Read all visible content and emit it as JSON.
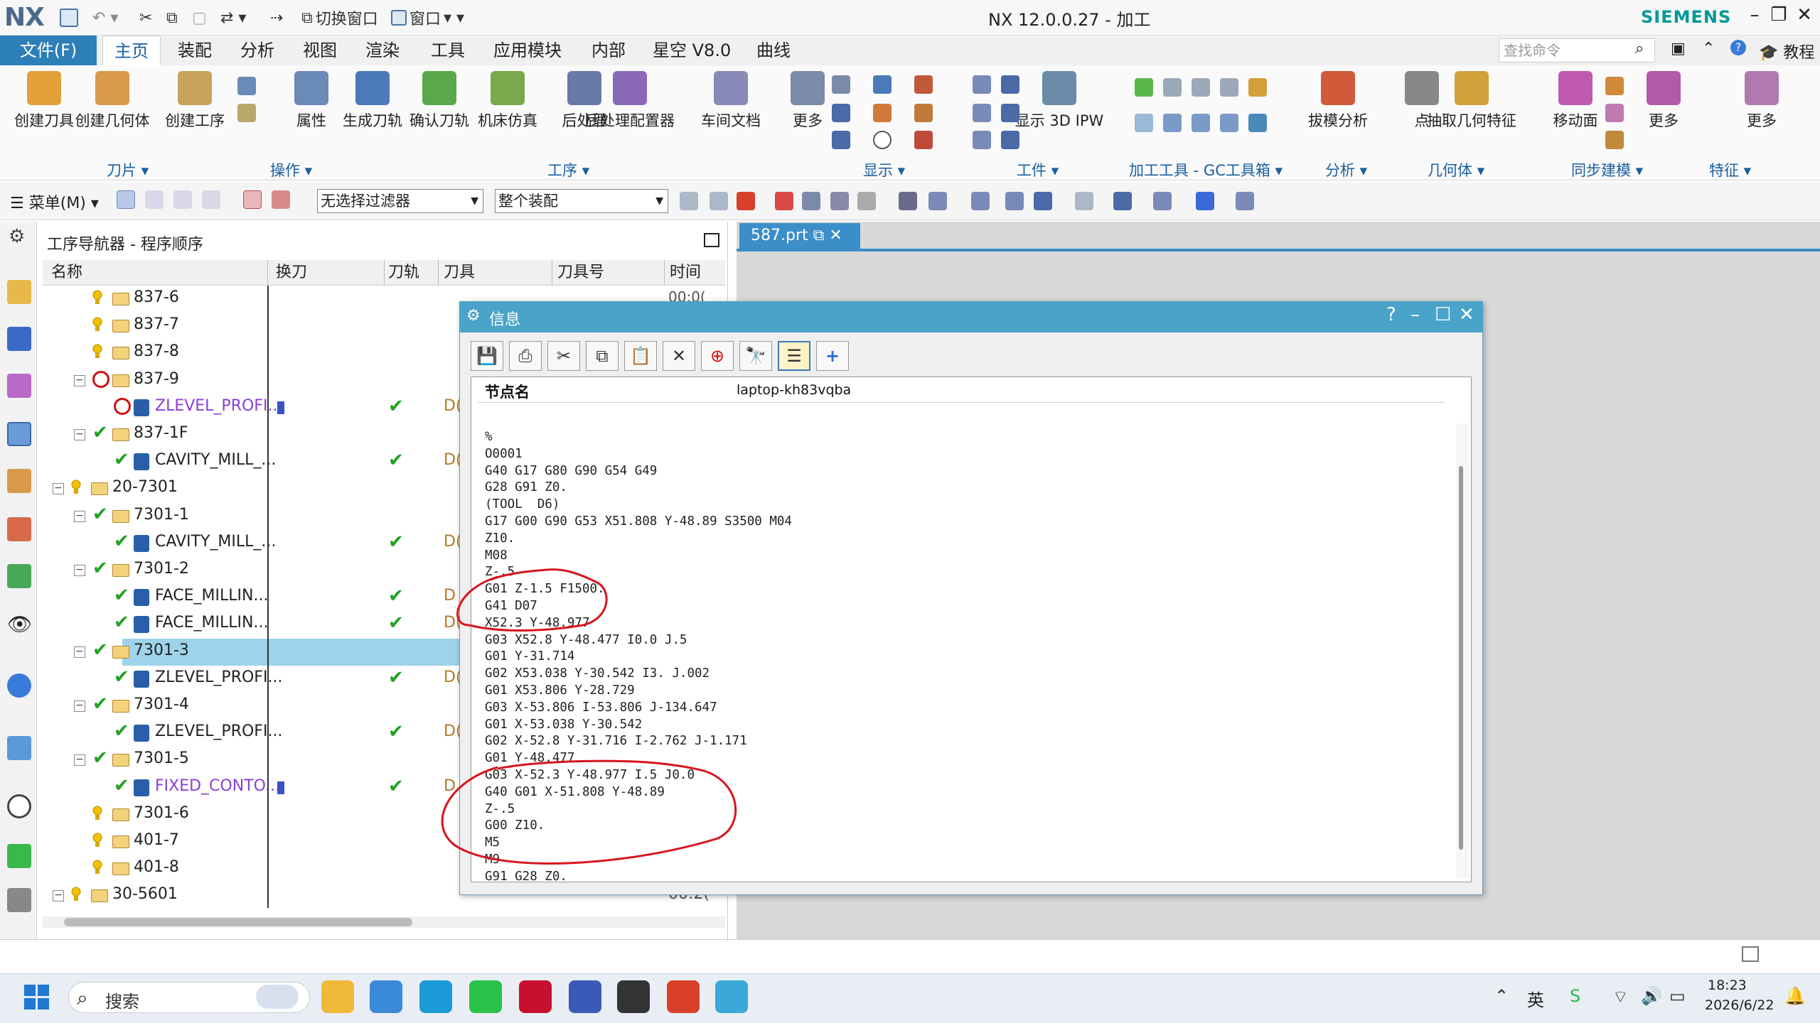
{
  "titlebar": {
    "logo": "NX",
    "switch_window": "切换窗口",
    "window": "窗口",
    "title": "NX 12.0.0.27 - 加工",
    "brand": "SIEMENS"
  },
  "menubar": {
    "file": "文件(F)",
    "tabs": [
      "主页",
      "装配",
      "分析",
      "视图",
      "渲染",
      "工具",
      "应用模块",
      "内部",
      "星空 V8.0",
      "曲线"
    ],
    "search_placeholder": "查找命令",
    "tutorial": "教程"
  },
  "ribbon": {
    "buttons": [
      {
        "label": "创建刀具",
        "icon": "create-tool-icon",
        "color": "#e3a13a"
      },
      {
        "label": "创建几何体",
        "icon": "create-geometry-icon",
        "color": "#d99a4a"
      },
      {
        "label": "创建工序",
        "icon": "create-operation-icon",
        "color": "#c7a45a"
      },
      {
        "label": "属性",
        "icon": "properties-icon",
        "color": "#6a8ab8"
      },
      {
        "label": "生成刀轨",
        "icon": "generate-toolpath-icon",
        "color": "#4a7ab8"
      },
      {
        "label": "确认刀轨",
        "icon": "verify-toolpath-icon",
        "color": "#5aa84a"
      },
      {
        "label": "机床仿真",
        "icon": "machine-simulation-icon",
        "color": "#7aa84a"
      },
      {
        "label": "后处理",
        "icon": "postprocess-icon",
        "color": "#6a7aa8"
      },
      {
        "label": "后处理配置器",
        "icon": "post-configurator-icon",
        "color": "#8a6ab8"
      },
      {
        "label": "车间文档",
        "icon": "shop-documentation-icon",
        "color": "#8a8ab8"
      },
      {
        "label": "更多",
        "icon": "more-icon",
        "color": "#7a8aa8"
      },
      {
        "label": "显示 3D IPW",
        "icon": "show-3d-ipw-icon",
        "color": "#6a8aa8"
      },
      {
        "label": "拔模分析",
        "icon": "draft-analysis-icon",
        "color": "#d05a3a"
      },
      {
        "label": "点",
        "icon": "point-icon",
        "color": "#888888"
      },
      {
        "label": "抽取几何特征",
        "icon": "extract-geometry-icon",
        "color": "#d0a03a"
      },
      {
        "label": "移动面",
        "icon": "move-face-icon",
        "color": "#c05ab0"
      },
      {
        "label": "更多",
        "icon": "more-icon-2",
        "color": "#b05aa8"
      },
      {
        "label": "更多",
        "icon": "more-icon-3",
        "color": "#b07ab0"
      }
    ],
    "groups": [
      "刀片",
      "操作",
      "工序",
      "显示",
      "工件",
      "加工工具 - GC工具箱",
      "分析",
      "几何体",
      "同步建模",
      "特征"
    ]
  },
  "toolbar2": {
    "menu": "菜单(M)",
    "filter": "无选择过滤器",
    "assembly": "整个装配"
  },
  "navigator": {
    "title": "工序导航器 - 程序顺序",
    "columns": [
      "名称",
      "换刀",
      "刀轨",
      "刀具",
      "刀具号",
      "时间"
    ],
    "first_time": "00:0(",
    "rows": [
      {
        "indent": 2,
        "toggle": "",
        "status": "bulb",
        "type": "folder",
        "name": "837-6",
        "purple": false,
        "bar": false,
        "tick": false,
        "tool": ""
      },
      {
        "indent": 2,
        "toggle": "",
        "status": "bulb",
        "type": "folder",
        "name": "837-7",
        "purple": false,
        "bar": false,
        "tick": false,
        "tool": ""
      },
      {
        "indent": 2,
        "toggle": "",
        "status": "bulb",
        "type": "folder",
        "name": "837-8",
        "purple": false,
        "bar": false,
        "tick": false,
        "tool": ""
      },
      {
        "indent": 2,
        "toggle": "−",
        "status": "forbid",
        "type": "folder",
        "name": "837-9",
        "purple": false,
        "bar": false,
        "tick": false,
        "tool": ""
      },
      {
        "indent": 3,
        "toggle": "",
        "status": "forbid",
        "type": "op",
        "name": "ZLEVEL_PROFI...",
        "purple": true,
        "bar": true,
        "tick": true,
        "tool": "D("
      },
      {
        "indent": 2,
        "toggle": "−",
        "status": "check",
        "type": "folder",
        "name": "837-1F",
        "purple": false,
        "bar": false,
        "tick": false,
        "tool": ""
      },
      {
        "indent": 3,
        "toggle": "",
        "status": "check",
        "type": "op",
        "name": "CAVITY_MILL_...",
        "purple": false,
        "bar": false,
        "tick": true,
        "tool": "D("
      },
      {
        "indent": 1,
        "toggle": "−",
        "status": "bulb",
        "type": "folder",
        "name": "20-7301",
        "purple": false,
        "bar": false,
        "tick": false,
        "tool": ""
      },
      {
        "indent": 2,
        "toggle": "−",
        "status": "check",
        "type": "folder",
        "name": "7301-1",
        "purple": false,
        "bar": false,
        "tick": false,
        "tool": ""
      },
      {
        "indent": 3,
        "toggle": "",
        "status": "check",
        "type": "op",
        "name": "CAVITY_MILL_...",
        "purple": false,
        "bar": false,
        "tick": true,
        "tool": "D("
      },
      {
        "indent": 2,
        "toggle": "−",
        "status": "check",
        "type": "folder",
        "name": "7301-2",
        "purple": false,
        "bar": false,
        "tick": false,
        "tool": ""
      },
      {
        "indent": 3,
        "toggle": "",
        "status": "check",
        "type": "op",
        "name": "FACE_MILLIN...",
        "purple": false,
        "bar": false,
        "tick": true,
        "tool": "D"
      },
      {
        "indent": 3,
        "toggle": "",
        "status": "check",
        "type": "op",
        "name": "FACE_MILLIN...",
        "purple": false,
        "bar": false,
        "tick": true,
        "tool": "D("
      },
      {
        "indent": 2,
        "toggle": "−",
        "status": "check",
        "type": "folder",
        "name": "7301-3",
        "purple": false,
        "bar": false,
        "tick": false,
        "tool": "",
        "selected": true
      },
      {
        "indent": 3,
        "toggle": "",
        "status": "check",
        "type": "op",
        "name": "ZLEVEL_PROFI...",
        "purple": false,
        "bar": false,
        "tick": true,
        "tool": "D("
      },
      {
        "indent": 2,
        "toggle": "−",
        "status": "check",
        "type": "folder",
        "name": "7301-4",
        "purple": false,
        "bar": false,
        "tick": false,
        "tool": ""
      },
      {
        "indent": 3,
        "toggle": "",
        "status": "check",
        "type": "op",
        "name": "ZLEVEL_PROFI...",
        "purple": false,
        "bar": false,
        "tick": true,
        "tool": "D("
      },
      {
        "indent": 2,
        "toggle": "−",
        "status": "check",
        "type": "folder",
        "name": "7301-5",
        "purple": false,
        "bar": false,
        "tick": false,
        "tool": ""
      },
      {
        "indent": 3,
        "toggle": "",
        "status": "check",
        "type": "op",
        "name": "FIXED_CONTO...",
        "purple": true,
        "bar": true,
        "tick": true,
        "tool": "D"
      },
      {
        "indent": 2,
        "toggle": "",
        "status": "bulb",
        "type": "folder",
        "name": "7301-6",
        "purple": false,
        "bar": false,
        "tick": false,
        "tool": ""
      },
      {
        "indent": 2,
        "toggle": "",
        "status": "bulb",
        "type": "folder",
        "name": "401-7",
        "purple": false,
        "bar": false,
        "tick": false,
        "tool": ""
      },
      {
        "indent": 2,
        "toggle": "",
        "status": "bulb",
        "type": "folder",
        "name": "401-8",
        "purple": false,
        "bar": false,
        "tick": false,
        "tool": ""
      },
      {
        "indent": 1,
        "toggle": "−",
        "status": "bulb",
        "type": "folder",
        "name": "30-5601",
        "purple": false,
        "bar": false,
        "tick": false,
        "tool": "",
        "time": "00:2("
      }
    ]
  },
  "graphics": {
    "file_tab": "587.prt"
  },
  "info_dialog": {
    "title": "信息",
    "node_label": "节点名",
    "node_value": "laptop-kh83vqba",
    "code_lines": [
      "%",
      "O0001",
      "G40 G17 G80 G90 G54 G49",
      "G28 G91 Z0.",
      "(TOOL  D6)",
      "G17 G00 G90 G53 X51.808 Y-48.89 S3500 M04",
      "Z10.",
      "M08",
      "Z-.5",
      "G01 Z-1.5 F1500.",
      "G41 D07",
      "X52.3 Y-48.977",
      "G03 X52.8 Y-48.477 I0.0 J.5",
      "G01 Y-31.714",
      "G02 X53.038 Y-30.542 I3. J.002",
      "G01 X53.806 Y-28.729",
      "G03 X-53.806 I-53.806 J-134.647",
      "G01 X-53.038 Y-30.542",
      "G02 X-52.8 Y-31.716 I-2.762 J-1.171",
      "G01 Y-48.477",
      "G03 X-52.3 Y-48.977 I.5 J0.0",
      "G40 G01 X-51.808 Y-48.89",
      "Z-.5",
      "G00 Z10.",
      "M5",
      "M9",
      "G91 G28 Z0."
    ]
  },
  "taskbar": {
    "search": "搜索",
    "time": "18:23",
    "date": "2026/6/22",
    "apps": [
      {
        "name": "file-explorer-icon",
        "color": "#f0b93a"
      },
      {
        "name": "app-icon-2",
        "color": "#3a8ad8"
      },
      {
        "name": "edge-icon",
        "color": "#1a9ad8"
      },
      {
        "name": "wechat-icon",
        "color": "#2ac14a"
      },
      {
        "name": "nx-app-icon",
        "color": "#c8102e"
      },
      {
        "name": "pen-icon",
        "color": "#3a5ab8"
      },
      {
        "name": "terminal-icon",
        "color": "#333333"
      },
      {
        "name": "grid-app-icon",
        "color": "#d8402a"
      },
      {
        "name": "globe-icon",
        "color": "#3aa8d8"
      }
    ],
    "tray_ime": "英"
  },
  "colors": {
    "accent": "#2d7fb8",
    "dialog_title": "#4aa3c8",
    "selected_row": "#9ed3ea",
    "annotation": "#d8141e"
  }
}
